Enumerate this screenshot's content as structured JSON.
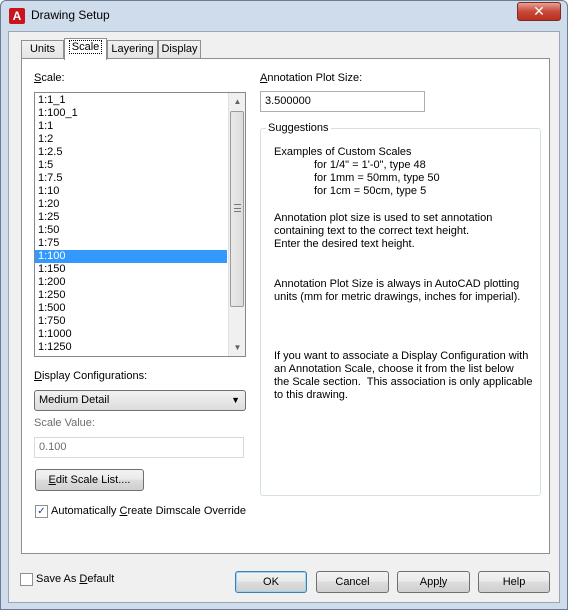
{
  "window": {
    "title": "Drawing Setup",
    "app_icon": "A",
    "close_glyph": "✕"
  },
  "tabs": [
    {
      "label": "Units"
    },
    {
      "label": "Scale"
    },
    {
      "label": "Layering"
    },
    {
      "label": "Display"
    }
  ],
  "scale": {
    "label_mnemonic": "S",
    "label_rest": "cale:",
    "items": [
      "1:1_1",
      "1:100_1",
      "1:1",
      "1:2",
      "1:2.5",
      "1:5",
      "1:7.5",
      "1:10",
      "1:20",
      "1:25",
      "1:50",
      "1:75",
      "1:100",
      "1:150",
      "1:200",
      "1:250",
      "1:500",
      "1:750",
      "1:1000",
      "1:1250"
    ],
    "selected": "1:100"
  },
  "display_config": {
    "label_mnemonic": "D",
    "label_rest": "isplay Configurations:",
    "value": "Medium Detail"
  },
  "scale_value": {
    "label": "Scale Value:",
    "value": "0.100"
  },
  "edit_scale_button": {
    "label_mnemonic": "E",
    "label_rest": "dit Scale List...."
  },
  "auto_dimscale": {
    "checked": true,
    "check_glyph": "✓",
    "label_pre": "Automatically ",
    "label_mnemonic": "C",
    "label_post": "reate Dimscale Override"
  },
  "annotation": {
    "label_mnemonic": "A",
    "label_rest": "nnotation Plot Size:",
    "value": "3.500000"
  },
  "suggestions": {
    "legend": "Suggestions",
    "examples_title": "Examples of Custom Scales",
    "examples": [
      "for 1/4\" = 1'-0\", type 48",
      "for 1mm = 50mm, type 50",
      "for 1cm = 50cm, type 5"
    ],
    "para1": [
      "Annotation plot size is used to set annotation",
      "containing text to the correct text height.",
      "Enter the desired text height."
    ],
    "para2": [
      "Annotation Plot Size is always in AutoCAD plotting",
      "units (mm for metric drawings, inches for imperial)."
    ],
    "para3": [
      "If you want to associate a Display Configuration with",
      "an Annotation Scale, choose it from the list below",
      "the Scale section.  This association is only applicable",
      "to this drawing."
    ]
  },
  "save_default": {
    "checked": false,
    "label_pre": "Save As ",
    "label_mnemonic": "D",
    "label_post": "efault"
  },
  "buttons": {
    "ok": "OK",
    "cancel": "Cancel",
    "apply_pre": "App",
    "apply_mnemonic": "l",
    "apply_post": "y",
    "help": "Help"
  },
  "scroll": {
    "up_glyph": "▲",
    "down_glyph": "▼"
  },
  "combo_arrow_glyph": "▼"
}
